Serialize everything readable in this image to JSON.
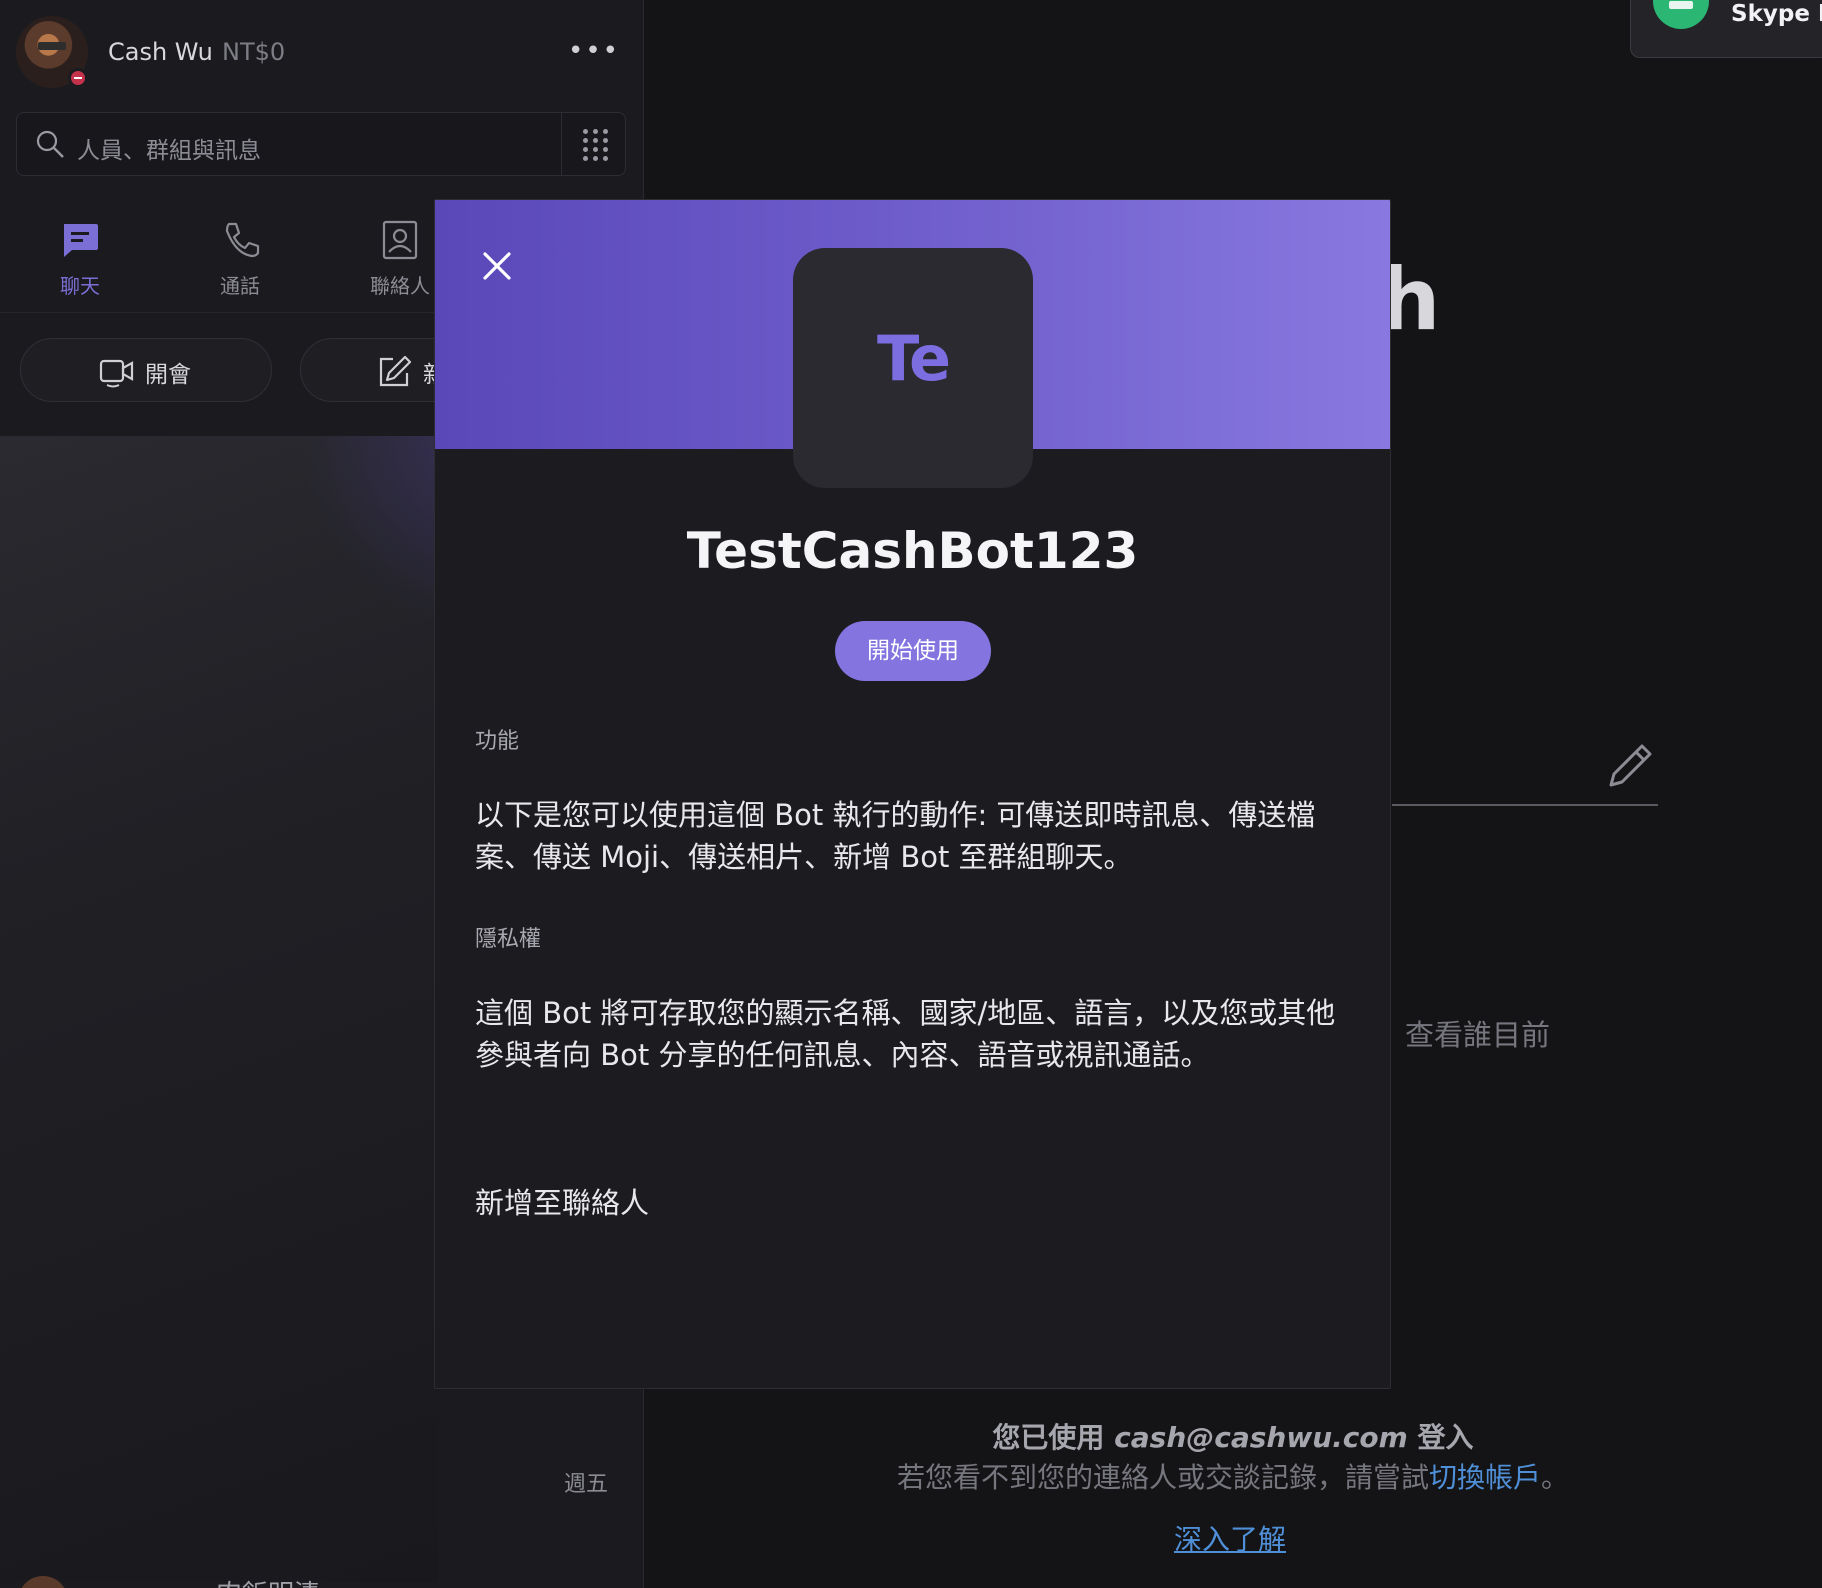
{
  "profile": {
    "name": "Cash Wu",
    "balance": "NT$0",
    "more_label": "•••"
  },
  "search": {
    "placeholder": "人員、群組與訊息"
  },
  "nav": {
    "items": [
      {
        "label": "聊天",
        "icon": "chat-icon"
      },
      {
        "label": "通話",
        "icon": "phone-icon"
      },
      {
        "label": "聯絡人",
        "icon": "contacts-icon"
      }
    ]
  },
  "actions": {
    "meet_label": "開會",
    "new_chat_label": "新"
  },
  "chat_list": {
    "day_label": "週五",
    "partial_item": "　　　　肉飯明清"
  },
  "main": {
    "title_fragment": "sh",
    "behind_text": "，查看誰目前",
    "signed_in_prefix": "您已使用 ",
    "signed_in_email": "cash@cashwu.com",
    "signed_in_suffix": " 登入",
    "hint_prefix": "若您看不到您的連絡人或交談記錄，請嘗試",
    "hint_link": "切換帳戶",
    "hint_suffix": "。",
    "learn_more": "深入了解"
  },
  "toast": {
    "title": "Skype He"
  },
  "dialog": {
    "avatar_text": "Te",
    "bot_name": "TestCashBot123",
    "start_button": "開始使用",
    "features_label": "功能",
    "features_text": "以下是您可以使用這個 Bot 執行的動作: 可傳送即時訊息、傳送檔案、傳送 Moji、傳送相片、新增 Bot 至群組聊天。",
    "privacy_label": "隱私權",
    "privacy_text": "這個 Bot 將可存取您的顯示名稱、國家/地區、語言，以及您或其他參與者向 Bot 分享的任何訊息、內容、語音或視訊通話。",
    "add_contact": "新增至聯絡人"
  },
  "colors": {
    "accent": "#8374e0",
    "header_start": "#5a48b8",
    "header_end": "#8878df",
    "link": "#4f8fd8",
    "presence_busy": "#c4314b"
  }
}
